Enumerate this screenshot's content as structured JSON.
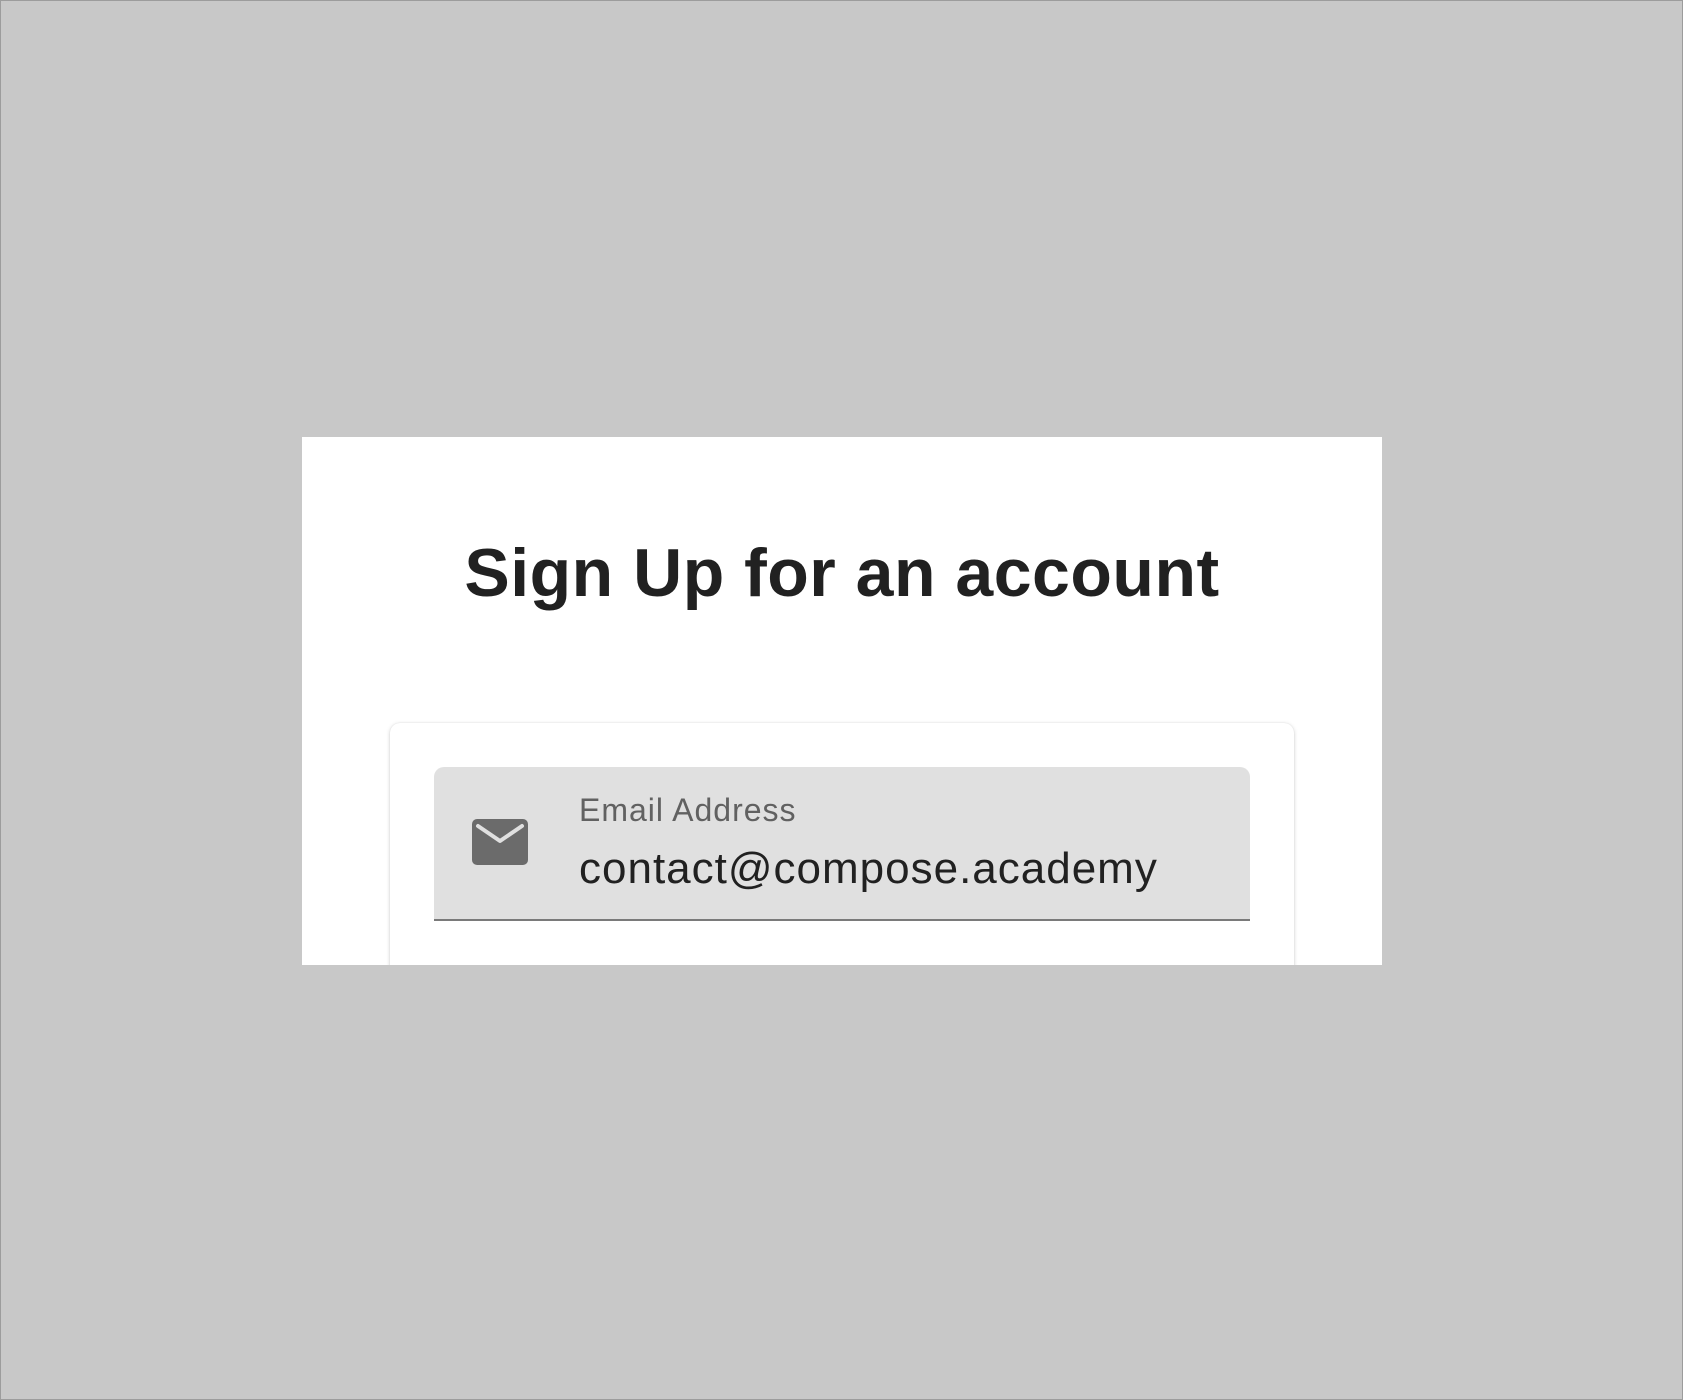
{
  "signup": {
    "title": "Sign Up for an account"
  },
  "email_field": {
    "label": "Email Address",
    "value": "contact@compose.academy",
    "icon": "email-envelope-icon"
  },
  "colors": {
    "backdrop": "#c8c8c8",
    "surface": "#ffffff",
    "field_fill": "#e0e0e0",
    "text_primary": "#212121",
    "text_secondary": "#616161",
    "icon": "#6b6b6b"
  }
}
